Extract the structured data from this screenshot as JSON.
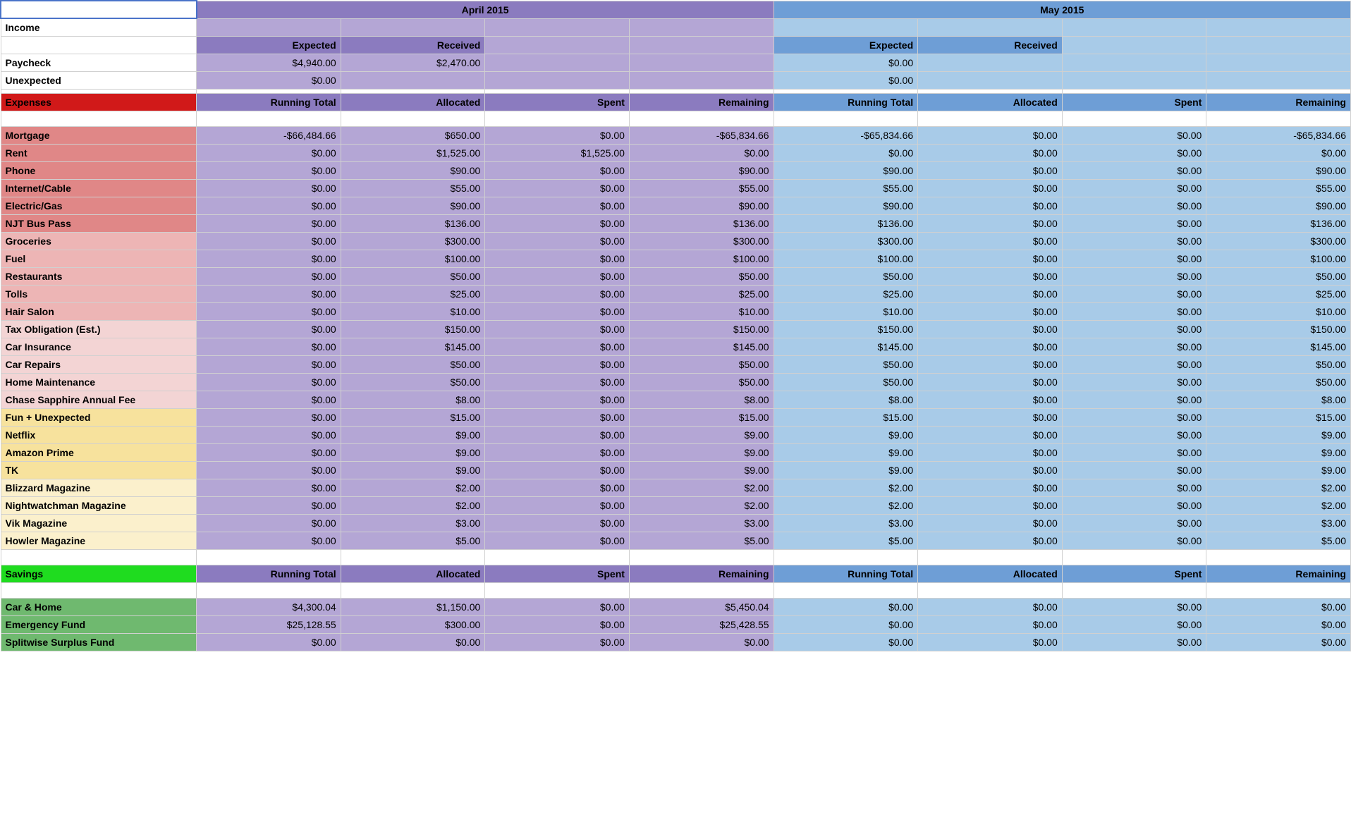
{
  "months": {
    "apr": "April 2015",
    "may": "May 2015"
  },
  "headers": {
    "income": "Income",
    "expected": "Expected",
    "received": "Received",
    "expenses": "Expenses",
    "runningTotal": "Running Total",
    "allocated": "Allocated",
    "spent": "Spent",
    "remaining": "Remaining",
    "savings": "Savings"
  },
  "incomeRows": [
    {
      "label": "Paycheck",
      "aprExp": "$4,940.00",
      "aprRec": "$2,470.00",
      "mayExp": "$0.00",
      "mayRec": ""
    },
    {
      "label": "Unexpected",
      "aprExp": "$0.00",
      "aprRec": "",
      "mayExp": "$0.00",
      "mayRec": ""
    }
  ],
  "expenseRows": [
    {
      "cls": "lbl-red1",
      "label": "Mortgage",
      "a": [
        "-$66,484.66",
        "$650.00",
        "$0.00",
        "-$65,834.66"
      ],
      "m": [
        "-$65,834.66",
        "$0.00",
        "$0.00",
        "-$65,834.66"
      ]
    },
    {
      "cls": "lbl-red1",
      "label": "Rent",
      "a": [
        "$0.00",
        "$1,525.00",
        "$1,525.00",
        "$0.00"
      ],
      "m": [
        "$0.00",
        "$0.00",
        "$0.00",
        "$0.00"
      ]
    },
    {
      "cls": "lbl-red1",
      "label": "Phone",
      "a": [
        "$0.00",
        "$90.00",
        "$0.00",
        "$90.00"
      ],
      "m": [
        "$90.00",
        "$0.00",
        "$0.00",
        "$90.00"
      ]
    },
    {
      "cls": "lbl-red1",
      "label": "Internet/Cable",
      "a": [
        "$0.00",
        "$55.00",
        "$0.00",
        "$55.00"
      ],
      "m": [
        "$55.00",
        "$0.00",
        "$0.00",
        "$55.00"
      ]
    },
    {
      "cls": "lbl-red1",
      "label": "Electric/Gas",
      "a": [
        "$0.00",
        "$90.00",
        "$0.00",
        "$90.00"
      ],
      "m": [
        "$90.00",
        "$0.00",
        "$0.00",
        "$90.00"
      ]
    },
    {
      "cls": "lbl-red1",
      "label": "NJT Bus Pass",
      "a": [
        "$0.00",
        "$136.00",
        "$0.00",
        "$136.00"
      ],
      "m": [
        "$136.00",
        "$0.00",
        "$0.00",
        "$136.00"
      ]
    },
    {
      "cls": "lbl-red2",
      "label": "Groceries",
      "a": [
        "$0.00",
        "$300.00",
        "$0.00",
        "$300.00"
      ],
      "m": [
        "$300.00",
        "$0.00",
        "$0.00",
        "$300.00"
      ]
    },
    {
      "cls": "lbl-red2",
      "label": "Fuel",
      "a": [
        "$0.00",
        "$100.00",
        "$0.00",
        "$100.00"
      ],
      "m": [
        "$100.00",
        "$0.00",
        "$0.00",
        "$100.00"
      ]
    },
    {
      "cls": "lbl-red2",
      "label": "Restaurants",
      "a": [
        "$0.00",
        "$50.00",
        "$0.00",
        "$50.00"
      ],
      "m": [
        "$50.00",
        "$0.00",
        "$0.00",
        "$50.00"
      ]
    },
    {
      "cls": "lbl-red2",
      "label": "Tolls",
      "a": [
        "$0.00",
        "$25.00",
        "$0.00",
        "$25.00"
      ],
      "m": [
        "$25.00",
        "$0.00",
        "$0.00",
        "$25.00"
      ]
    },
    {
      "cls": "lbl-red2",
      "label": "Hair Salon",
      "a": [
        "$0.00",
        "$10.00",
        "$0.00",
        "$10.00"
      ],
      "m": [
        "$10.00",
        "$0.00",
        "$0.00",
        "$10.00"
      ]
    },
    {
      "cls": "lbl-red3",
      "label": "Tax Obligation (Est.)",
      "a": [
        "$0.00",
        "$150.00",
        "$0.00",
        "$150.00"
      ],
      "m": [
        "$150.00",
        "$0.00",
        "$0.00",
        "$150.00"
      ]
    },
    {
      "cls": "lbl-red3",
      "label": "Car Insurance",
      "a": [
        "$0.00",
        "$145.00",
        "$0.00",
        "$145.00"
      ],
      "m": [
        "$145.00",
        "$0.00",
        "$0.00",
        "$145.00"
      ]
    },
    {
      "cls": "lbl-red3",
      "label": "Car Repairs",
      "a": [
        "$0.00",
        "$50.00",
        "$0.00",
        "$50.00"
      ],
      "m": [
        "$50.00",
        "$0.00",
        "$0.00",
        "$50.00"
      ]
    },
    {
      "cls": "lbl-red3",
      "label": "Home Maintenance",
      "a": [
        "$0.00",
        "$50.00",
        "$0.00",
        "$50.00"
      ],
      "m": [
        "$50.00",
        "$0.00",
        "$0.00",
        "$50.00"
      ]
    },
    {
      "cls": "lbl-red3",
      "label": "Chase Sapphire Annual Fee",
      "a": [
        "$0.00",
        "$8.00",
        "$0.00",
        "$8.00"
      ],
      "m": [
        "$8.00",
        "$0.00",
        "$0.00",
        "$8.00"
      ]
    },
    {
      "cls": "lbl-yel1",
      "label": "Fun + Unexpected",
      "a": [
        "$0.00",
        "$15.00",
        "$0.00",
        "$15.00"
      ],
      "m": [
        "$15.00",
        "$0.00",
        "$0.00",
        "$15.00"
      ]
    },
    {
      "cls": "lbl-yel1",
      "label": "Netflix",
      "a": [
        "$0.00",
        "$9.00",
        "$0.00",
        "$9.00"
      ],
      "m": [
        "$9.00",
        "$0.00",
        "$0.00",
        "$9.00"
      ]
    },
    {
      "cls": "lbl-yel1",
      "label": "Amazon Prime",
      "a": [
        "$0.00",
        "$9.00",
        "$0.00",
        "$9.00"
      ],
      "m": [
        "$9.00",
        "$0.00",
        "$0.00",
        "$9.00"
      ]
    },
    {
      "cls": "lbl-yel1",
      "label": "TK",
      "a": [
        "$0.00",
        "$9.00",
        "$0.00",
        "$9.00"
      ],
      "m": [
        "$9.00",
        "$0.00",
        "$0.00",
        "$9.00"
      ]
    },
    {
      "cls": "lbl-yel2",
      "label": "Blizzard Magazine",
      "a": [
        "$0.00",
        "$2.00",
        "$0.00",
        "$2.00"
      ],
      "m": [
        "$2.00",
        "$0.00",
        "$0.00",
        "$2.00"
      ]
    },
    {
      "cls": "lbl-yel2",
      "label": "Nightwatchman Magazine",
      "a": [
        "$0.00",
        "$2.00",
        "$0.00",
        "$2.00"
      ],
      "m": [
        "$2.00",
        "$0.00",
        "$0.00",
        "$2.00"
      ]
    },
    {
      "cls": "lbl-yel2",
      "label": "Vik Magazine",
      "a": [
        "$0.00",
        "$3.00",
        "$0.00",
        "$3.00"
      ],
      "m": [
        "$3.00",
        "$0.00",
        "$0.00",
        "$3.00"
      ]
    },
    {
      "cls": "lbl-yel2",
      "label": "Howler Magazine",
      "a": [
        "$0.00",
        "$5.00",
        "$0.00",
        "$5.00"
      ],
      "m": [
        "$5.00",
        "$0.00",
        "$0.00",
        "$5.00"
      ]
    }
  ],
  "savingsRows": [
    {
      "cls": "lbl-grn",
      "label": "Car & Home",
      "a": [
        "$4,300.04",
        "$1,150.00",
        "$0.00",
        "$5,450.04"
      ],
      "m": [
        "$0.00",
        "$0.00",
        "$0.00",
        "$0.00"
      ]
    },
    {
      "cls": "lbl-grn",
      "label": "Emergency Fund",
      "a": [
        "$25,128.55",
        "$300.00",
        "$0.00",
        "$25,428.55"
      ],
      "m": [
        "$0.00",
        "$0.00",
        "$0.00",
        "$0.00"
      ]
    },
    {
      "cls": "lbl-grn",
      "label": "Splitwise Surplus Fund",
      "a": [
        "$0.00",
        "$0.00",
        "$0.00",
        "$0.00"
      ],
      "m": [
        "$0.00",
        "$0.00",
        "$0.00",
        "$0.00"
      ]
    }
  ]
}
